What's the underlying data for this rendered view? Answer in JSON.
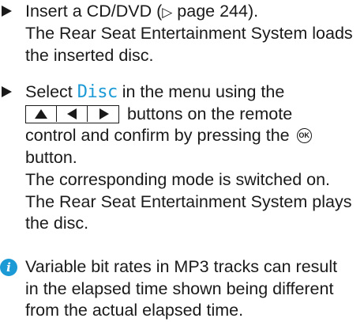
{
  "step1": {
    "line1_before": "Insert a CD/DVD (",
    "page_arrow": "▷",
    "line1_page": " page 244).",
    "line2": "The Rear Seat Entertainment System loads",
    "line3": "the inserted disc."
  },
  "step2": {
    "line1": "Select ",
    "menu_item": "Disc",
    "line1_after": " in the menu using the",
    "buttons": [
      "up-arrow",
      "left-arrow",
      "right-arrow"
    ],
    "line2_after": "buttons on the remote",
    "line3_before": "control and confirm by pressing the ",
    "ok_icon_label": "OK",
    "line4": "button.",
    "line5": "The corresponding mode is switched on.",
    "line6": "The Rear Seat Entertainment System plays",
    "line7": "the disc."
  },
  "note": {
    "icon": "info-icon",
    "icon_glyph": "i",
    "line1": "Variable bit rates in MP3 tracks can result",
    "line2": "in the elapsed time shown being different",
    "line3": "from the actual elapsed time."
  },
  "colors": {
    "text": "#1a1a1a",
    "accent": "#1b9ad6"
  }
}
